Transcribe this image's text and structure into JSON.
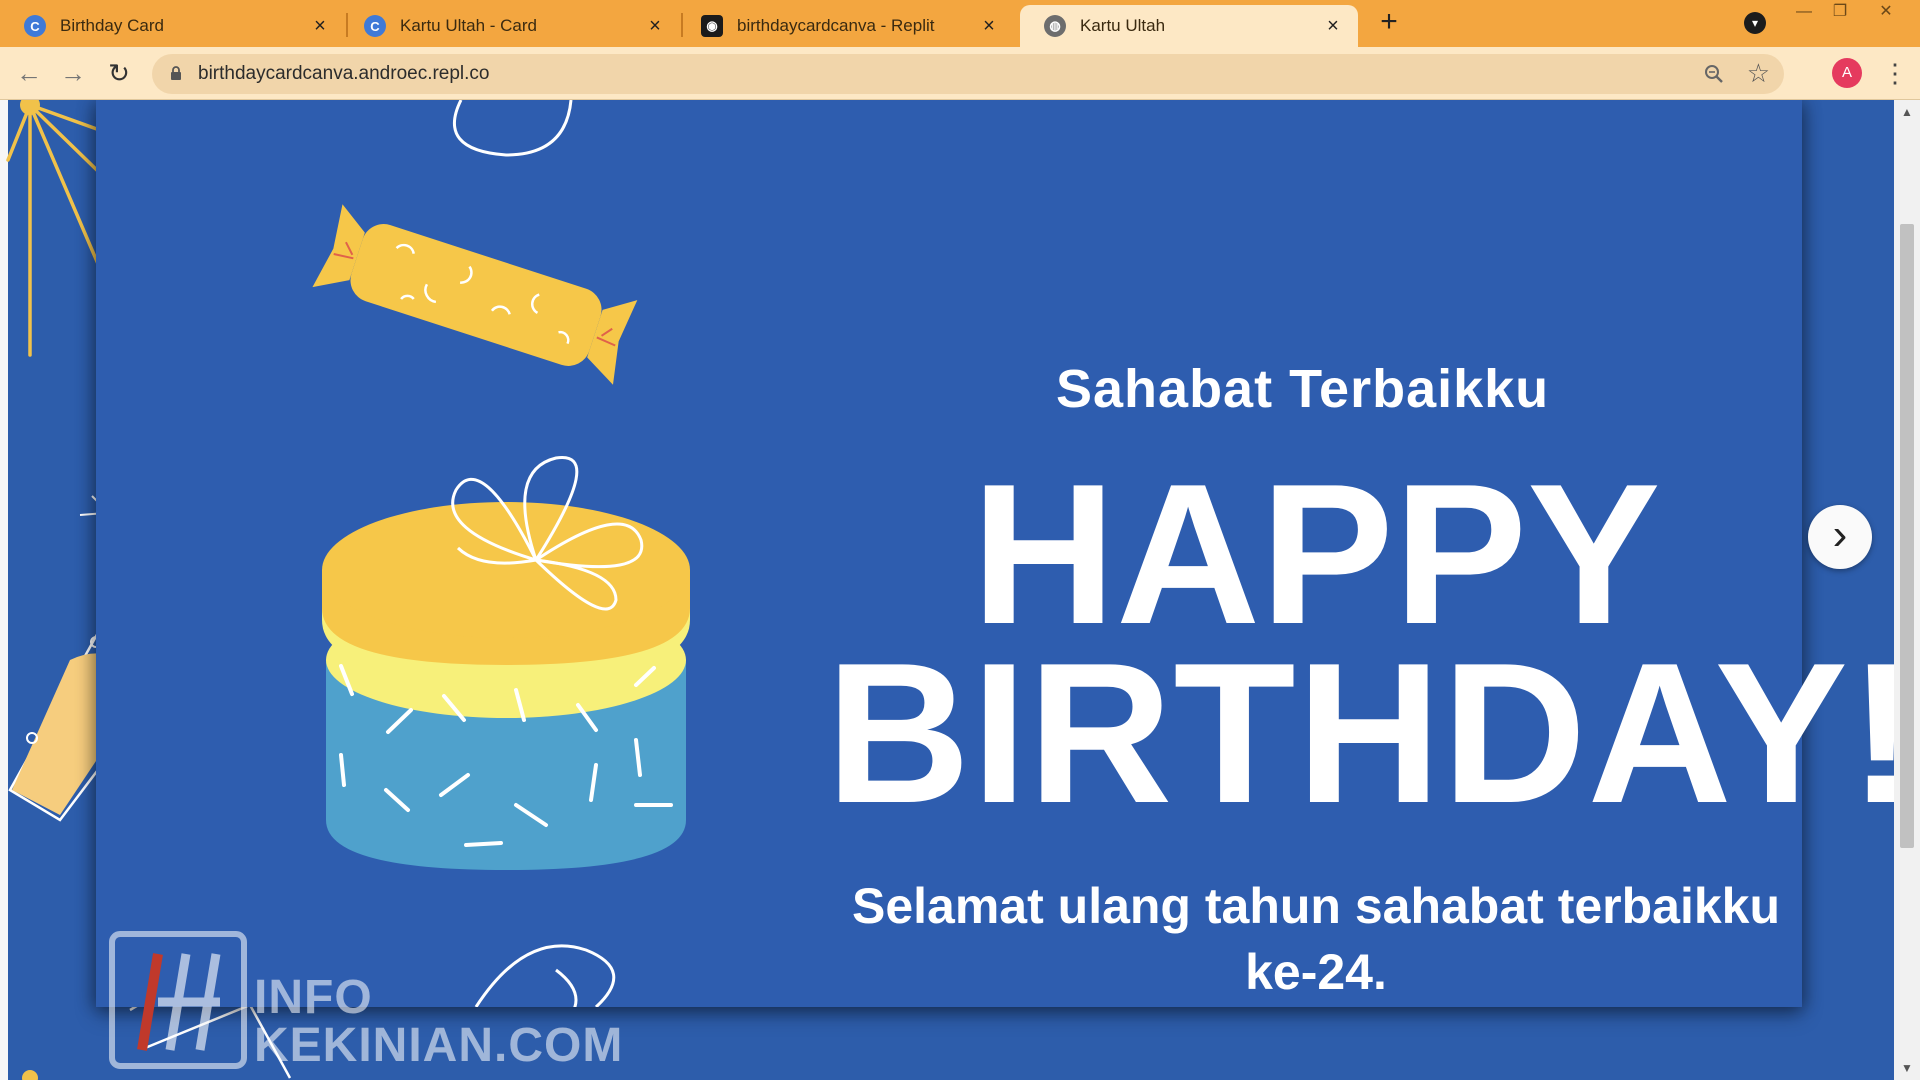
{
  "browser": {
    "tabs": [
      {
        "title": "Birthday Card",
        "favicon": "canva-icon",
        "active": false
      },
      {
        "title": "Kartu Ultah - Card",
        "favicon": "canva-icon",
        "active": false
      },
      {
        "title": "birthdaycardcanva - Replit",
        "favicon": "replit-icon",
        "active": false
      },
      {
        "title": "Kartu Ultah",
        "favicon": "globe-icon",
        "active": true
      }
    ],
    "new_tab_label": "+",
    "close_glyph": "×",
    "url": "birthdaycardcanva.androec.repl.co",
    "avatar_letter": "A",
    "colors": {
      "tab_strip": "#f3a640",
      "toolbar": "#fde8c5",
      "avatar": "#e53a5e"
    }
  },
  "card": {
    "subtitle": "Sahabat Terbaikku",
    "headline_line1": "HAPPY",
    "headline_line2": "BIRTHDAY!",
    "message": "Selamat ulang tahun sahabat terbaikku ke-24.",
    "colors": {
      "background": "#2e5daf",
      "text": "#ffffff",
      "gift_lid": "#f7c744",
      "gift_body": "#4ea0cc"
    }
  },
  "controls": {
    "next_glyph": "›"
  },
  "watermark": {
    "line1": "INFO",
    "line2": "KEKINIAN.COM"
  }
}
